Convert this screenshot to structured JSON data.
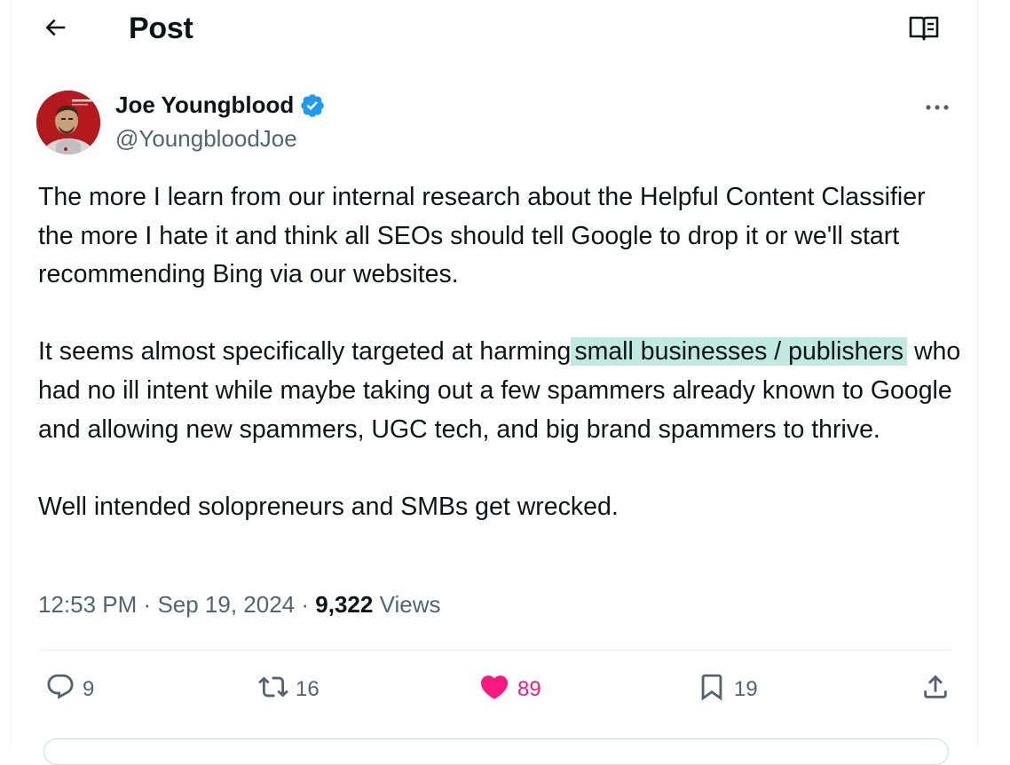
{
  "header": {
    "title": "Post",
    "back_icon": "arrow-left-icon",
    "reader_icon": "open-book-icon"
  },
  "author": {
    "name": "Joe Youngblood",
    "handle": "@YoungbloodJoe",
    "verified": true
  },
  "tweet": {
    "paragraph1": "The more I learn from our internal research about the Helpful Content Classifier the more I hate it and think all SEOs should tell Google to drop it or we'll start recommending Bing via our websites.",
    "paragraph2_before": "It seems almost specifically targeted at harming",
    "paragraph2_highlight": "small businesses / publishers",
    "paragraph2_after": "who had no ill intent while maybe taking out a few spammers already known to Google and allowing new spammers, UGC tech, and big brand spammers to thrive.",
    "paragraph3": "Well intended solopreneurs and SMBs get wrecked."
  },
  "meta": {
    "time": "12:53 PM",
    "date": "Sep 19, 2024",
    "separator": "·",
    "views_count": "9,322",
    "views_label": "Views"
  },
  "actions": {
    "replies": "9",
    "reposts": "16",
    "likes": "89",
    "bookmarks": "19"
  },
  "colors": {
    "accent": "#1d9bf0",
    "like": "#f91880",
    "secondary_text": "#536471",
    "highlight": "#c0e9e0"
  }
}
